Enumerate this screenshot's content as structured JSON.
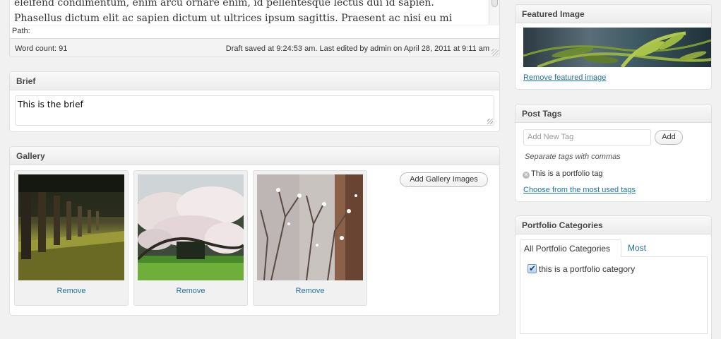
{
  "editor": {
    "lines": [
      "eleifend condimentum, enim arcu ornare enim, id pellentesque lectus dui id sapien.",
      "Phasellus dictum elit ac sapien dictum ut ultrices ipsum sagittis. Praesent ac nisi eu mi"
    ],
    "path_label": "Path:",
    "word_count": "Word count: 91",
    "draft_saved": "Draft saved at 9:24:53 am. Last edited by admin on April 28, 2011 at 9:11 am"
  },
  "brief": {
    "title": "Brief",
    "value": "This is the brief"
  },
  "gallery": {
    "title": "Gallery",
    "add_button": "Add Gallery Images",
    "items": [
      {
        "image": "tree-lined-path-photo",
        "remove": "Remove"
      },
      {
        "image": "cherry-blossom-photo",
        "remove": "Remove"
      },
      {
        "image": "snowy-branches-photo",
        "remove": "Remove"
      }
    ]
  },
  "featured_image": {
    "title": "Featured Image",
    "image": "fern-leaves-photo",
    "remove_link": "Remove featured image"
  },
  "post_tags": {
    "title": "Post Tags",
    "input_placeholder": "Add New Tag",
    "add_button": "Add",
    "hint": "Separate tags with commas",
    "tags": [
      "This is a portfolio tag"
    ],
    "choose_link": "Choose from the most used tags"
  },
  "portfolio_categories": {
    "title": "Portfolio Categories",
    "tabs": [
      "All Portfolio Categories",
      "Most Used"
    ],
    "items": [
      {
        "label": "this is a portfolio category",
        "checked": true
      }
    ]
  },
  "colors": {
    "link": "#21759b",
    "box_border": "#dfdfdf",
    "page_background": "#f1f1f1"
  }
}
